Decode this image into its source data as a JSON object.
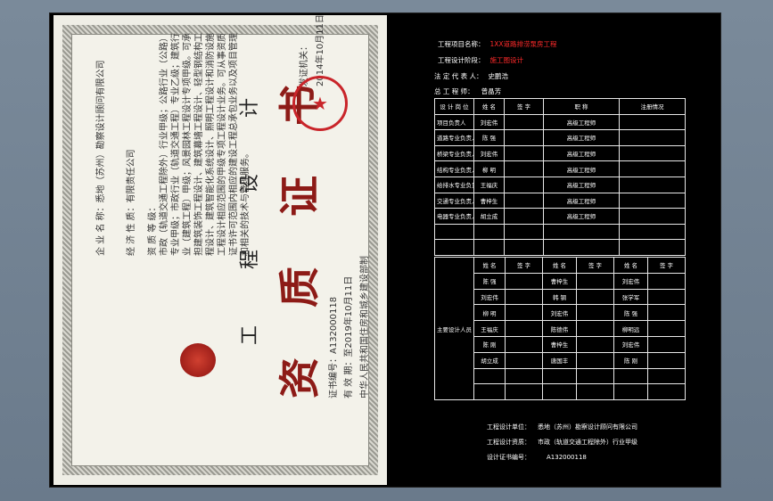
{
  "certificate": {
    "title_small": "工 程 设 计",
    "title_big": "资 质 证 书",
    "enterprise_label": "企 业 名 称：",
    "enterprise_value": "悉地（苏州）勘察设计顾问有限公司",
    "nature_label": "经 济 性 质：",
    "nature_value": "有限责任公司",
    "grade_label": "资 质 等 级：",
    "grade_text": "市政（轨道交通工程除外）行业甲级；公路行业（公路）专业甲级；市政行业（轨道交通工程）专业乙级；建筑行业（建筑工程）甲级；风景园林工程设计专项甲级。可承担建筑装饰工程设计、建筑幕墙工程设计、轻型钢结构工程设计、建筑智能化系统设计、照明工程设计和消防设施工程设计相应范围的甲级专项工程设计业务。可从事资质证书许可范围内相应的建设工程总承包业务以及项目管理和相关的技术与管理服务。",
    "cert_no_label": "证书编号：",
    "cert_no": "A132000118",
    "valid_label": "有 效 期：",
    "valid_to": "至2019年10月11日",
    "issuer": "中华人民共和国住房和城乡建设部制",
    "issue_org": "发证机关：",
    "issue_date": "2014年10月11日"
  },
  "sheet": {
    "project_label": "工程项目名称：",
    "project_value": "1XX道路排涝泵房工程",
    "phase_label": "工程设计阶段：",
    "phase_value": "施工图设计",
    "legal_label": "法 定 代 表 人：",
    "legal_value": "史鹏浩",
    "engineer_label": "总 工 程 师：",
    "engineer_value": "曾晶芳",
    "header": [
      "设 计 岗 位",
      "姓 名",
      "签 字",
      "职 称",
      "注册情况"
    ],
    "roles": [
      {
        "role": "项目负责人",
        "name": "刘宏伟",
        "title": "高级工程师"
      },
      {
        "role": "道路专业负责人",
        "name": "陈 强",
        "title": "高级工程师"
      },
      {
        "role": "桥梁专业负责人",
        "name": "刘宏伟",
        "title": "高级工程师"
      },
      {
        "role": "结构专业负责人",
        "name": "柳 明",
        "title": "高级工程师"
      },
      {
        "role": "给排水专业负责人",
        "name": "王福庆",
        "title": "高级工程师"
      },
      {
        "role": "交通专业负责人",
        "name": "曹梓生",
        "title": "高级工程师"
      },
      {
        "role": "电器专业负责人",
        "name": "胡立成",
        "title": "高级工程师"
      }
    ],
    "staff_label": "主要设计人员",
    "staff_header": [
      "姓 名",
      "签 字",
      "姓 名",
      "签 字",
      "姓 名",
      "签 字"
    ],
    "staff": [
      [
        "陈 强",
        "曹梓生",
        "刘宏伟"
      ],
      [
        "刘宏伟",
        "韩 钢",
        "张学军"
      ],
      [
        "柳 明",
        "刘宏伟",
        "陈 强"
      ],
      [
        "王福庆",
        "陈德伟",
        "柳明远"
      ],
      [
        "陈 刚",
        "曹梓生",
        "刘宏伟"
      ],
      [
        "胡立成",
        "唐国丰",
        "陈 刚"
      ]
    ],
    "footer": {
      "unit_label": "工程设计单位：",
      "unit_value": "悉地（苏州）勘察设计顾问有限公司",
      "grade_label": "工程设计资质：",
      "grade_value": "市政（轨道交通工程除外）行业甲级",
      "cert_label": "设计证书编号：",
      "cert_value": "A132000118"
    }
  },
  "colors": {
    "background": "#6d7d8e",
    "sheet": "#000000",
    "line": "#e8e8e8",
    "red": "#ff2a2a",
    "magenta": "#ff36ff",
    "green": "#5dff5d",
    "cyan": "#3fe8ff",
    "blue": "#3a7dff",
    "seal": "#c9252a"
  }
}
